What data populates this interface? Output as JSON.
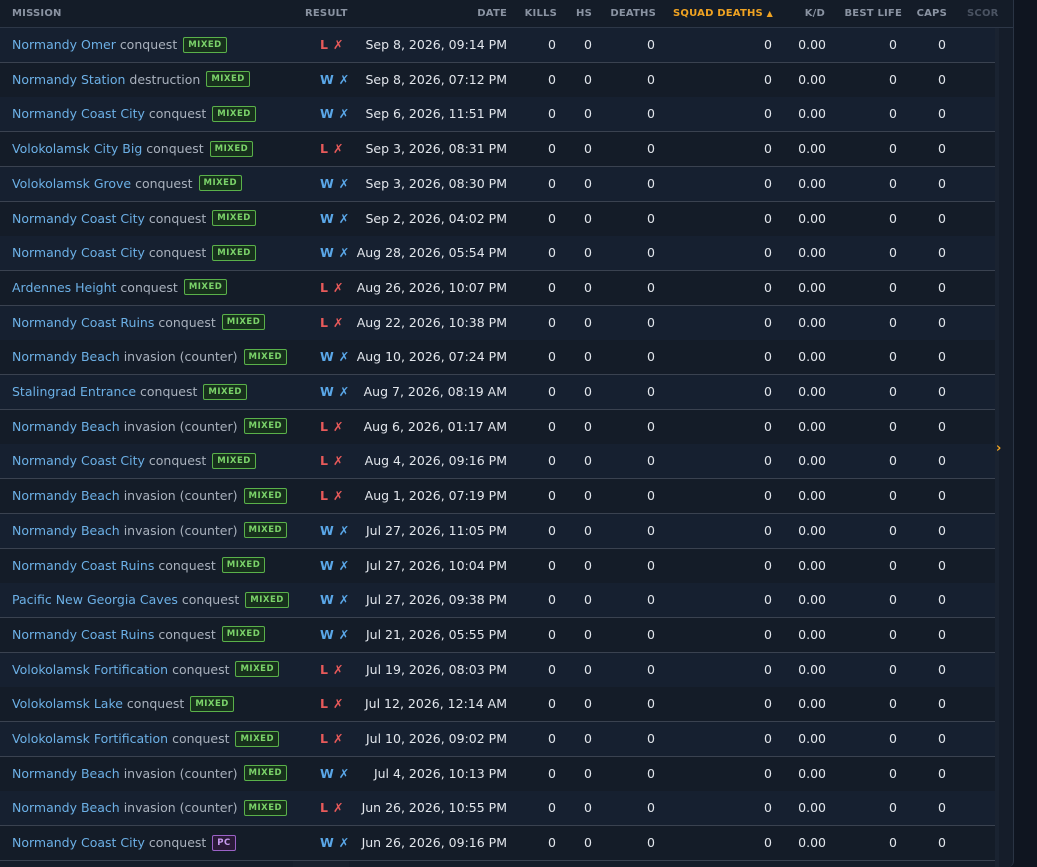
{
  "columns": {
    "mission": "MISSION",
    "result": "RESULT",
    "date": "DATE",
    "kills": "KILLS",
    "hs": "HS",
    "deaths": "DEATHS",
    "squad_deaths": "SQUAD DEATHS",
    "squad_deaths_sort": "▲",
    "kd": "K/D",
    "best_life": "BEST LIFE",
    "caps": "CAPS",
    "score": "SCOR"
  },
  "rows": [
    {
      "name": "Normandy Omer",
      "mode": "conquest",
      "badge": "MIXED",
      "result": "L",
      "date": "Sep 8, 2026, 09:14 PM",
      "kills": "0",
      "hs": "0",
      "deaths": "0",
      "squad_deaths": "0",
      "kd": "0.00",
      "best_life": "0",
      "caps": "0"
    },
    {
      "name": "Normandy Station",
      "mode": "destruction",
      "badge": "MIXED",
      "result": "W",
      "date": "Sep 8, 2026, 07:12 PM",
      "kills": "0",
      "hs": "0",
      "deaths": "0",
      "squad_deaths": "0",
      "kd": "0.00",
      "best_life": "0",
      "caps": "0"
    },
    {
      "name": "Normandy Coast City",
      "mode": "conquest",
      "badge": "MIXED",
      "result": "W",
      "date": "Sep 6, 2026, 11:51 PM",
      "kills": "0",
      "hs": "0",
      "deaths": "0",
      "squad_deaths": "0",
      "kd": "0.00",
      "best_life": "0",
      "caps": "0"
    },
    {
      "name": "Volokolamsk City Big",
      "mode": "conquest",
      "badge": "MIXED",
      "result": "L",
      "date": "Sep 3, 2026, 08:31 PM",
      "kills": "0",
      "hs": "0",
      "deaths": "0",
      "squad_deaths": "0",
      "kd": "0.00",
      "best_life": "0",
      "caps": "0"
    },
    {
      "name": "Volokolamsk Grove",
      "mode": "conquest",
      "badge": "MIXED",
      "result": "W",
      "date": "Sep 3, 2026, 08:30 PM",
      "kills": "0",
      "hs": "0",
      "deaths": "0",
      "squad_deaths": "0",
      "kd": "0.00",
      "best_life": "0",
      "caps": "0"
    },
    {
      "name": "Normandy Coast City",
      "mode": "conquest",
      "badge": "MIXED",
      "result": "W",
      "date": "Sep 2, 2026, 04:02 PM",
      "kills": "0",
      "hs": "0",
      "deaths": "0",
      "squad_deaths": "0",
      "kd": "0.00",
      "best_life": "0",
      "caps": "0"
    },
    {
      "name": "Normandy Coast City",
      "mode": "conquest",
      "badge": "MIXED",
      "result": "W",
      "date": "Aug 28, 2026, 05:54 PM",
      "kills": "0",
      "hs": "0",
      "deaths": "0",
      "squad_deaths": "0",
      "kd": "0.00",
      "best_life": "0",
      "caps": "0"
    },
    {
      "name": "Ardennes Height",
      "mode": "conquest",
      "badge": "MIXED",
      "result": "L",
      "date": "Aug 26, 2026, 10:07 PM",
      "kills": "0",
      "hs": "0",
      "deaths": "0",
      "squad_deaths": "0",
      "kd": "0.00",
      "best_life": "0",
      "caps": "0"
    },
    {
      "name": "Normandy Coast Ruins",
      "mode": "conquest",
      "badge": "MIXED",
      "result": "L",
      "date": "Aug 22, 2026, 10:38 PM",
      "kills": "0",
      "hs": "0",
      "deaths": "0",
      "squad_deaths": "0",
      "kd": "0.00",
      "best_life": "0",
      "caps": "0"
    },
    {
      "name": "Normandy Beach",
      "mode": "invasion (counter)",
      "badge": "MIXED",
      "result": "W",
      "date": "Aug 10, 2026, 07:24 PM",
      "kills": "0",
      "hs": "0",
      "deaths": "0",
      "squad_deaths": "0",
      "kd": "0.00",
      "best_life": "0",
      "caps": "0"
    },
    {
      "name": "Stalingrad Entrance",
      "mode": "conquest",
      "badge": "MIXED",
      "result": "W",
      "date": "Aug 7, 2026, 08:19 AM",
      "kills": "0",
      "hs": "0",
      "deaths": "0",
      "squad_deaths": "0",
      "kd": "0.00",
      "best_life": "0",
      "caps": "0"
    },
    {
      "name": "Normandy Beach",
      "mode": "invasion (counter)",
      "badge": "MIXED",
      "result": "L",
      "date": "Aug 6, 2026, 01:17 AM",
      "kills": "0",
      "hs": "0",
      "deaths": "0",
      "squad_deaths": "0",
      "kd": "0.00",
      "best_life": "0",
      "caps": "0"
    },
    {
      "name": "Normandy Coast City",
      "mode": "conquest",
      "badge": "MIXED",
      "result": "L",
      "date": "Aug 4, 2026, 09:16 PM",
      "kills": "0",
      "hs": "0",
      "deaths": "0",
      "squad_deaths": "0",
      "kd": "0.00",
      "best_life": "0",
      "caps": "0"
    },
    {
      "name": "Normandy Beach",
      "mode": "invasion (counter)",
      "badge": "MIXED",
      "result": "L",
      "date": "Aug 1, 2026, 07:19 PM",
      "kills": "0",
      "hs": "0",
      "deaths": "0",
      "squad_deaths": "0",
      "kd": "0.00",
      "best_life": "0",
      "caps": "0"
    },
    {
      "name": "Normandy Beach",
      "mode": "invasion (counter)",
      "badge": "MIXED",
      "result": "W",
      "date": "Jul 27, 2026, 11:05 PM",
      "kills": "0",
      "hs": "0",
      "deaths": "0",
      "squad_deaths": "0",
      "kd": "0.00",
      "best_life": "0",
      "caps": "0"
    },
    {
      "name": "Normandy Coast Ruins",
      "mode": "conquest",
      "badge": "MIXED",
      "result": "W",
      "date": "Jul 27, 2026, 10:04 PM",
      "kills": "0",
      "hs": "0",
      "deaths": "0",
      "squad_deaths": "0",
      "kd": "0.00",
      "best_life": "0",
      "caps": "0"
    },
    {
      "name": "Pacific New Georgia Caves",
      "mode": "conquest",
      "badge": "MIXED",
      "result": "W",
      "date": "Jul 27, 2026, 09:38 PM",
      "kills": "0",
      "hs": "0",
      "deaths": "0",
      "squad_deaths": "0",
      "kd": "0.00",
      "best_life": "0",
      "caps": "0"
    },
    {
      "name": "Normandy Coast Ruins",
      "mode": "conquest",
      "badge": "MIXED",
      "result": "W",
      "date": "Jul 21, 2026, 05:55 PM",
      "kills": "0",
      "hs": "0",
      "deaths": "0",
      "squad_deaths": "0",
      "kd": "0.00",
      "best_life": "0",
      "caps": "0"
    },
    {
      "name": "Volokolamsk Fortification",
      "mode": "conquest",
      "badge": "MIXED",
      "result": "L",
      "date": "Jul 19, 2026, 08:03 PM",
      "kills": "0",
      "hs": "0",
      "deaths": "0",
      "squad_deaths": "0",
      "kd": "0.00",
      "best_life": "0",
      "caps": "0"
    },
    {
      "name": "Volokolamsk Lake",
      "mode": "conquest",
      "badge": "MIXED",
      "result": "L",
      "date": "Jul 12, 2026, 12:14 AM",
      "kills": "0",
      "hs": "0",
      "deaths": "0",
      "squad_deaths": "0",
      "kd": "0.00",
      "best_life": "0",
      "caps": "0"
    },
    {
      "name": "Volokolamsk Fortification",
      "mode": "conquest",
      "badge": "MIXED",
      "result": "L",
      "date": "Jul 10, 2026, 09:02 PM",
      "kills": "0",
      "hs": "0",
      "deaths": "0",
      "squad_deaths": "0",
      "kd": "0.00",
      "best_life": "0",
      "caps": "0"
    },
    {
      "name": "Normandy Beach",
      "mode": "invasion (counter)",
      "badge": "MIXED",
      "result": "W",
      "date": "Jul 4, 2026, 10:13 PM",
      "kills": "0",
      "hs": "0",
      "deaths": "0",
      "squad_deaths": "0",
      "kd": "0.00",
      "best_life": "0",
      "caps": "0"
    },
    {
      "name": "Normandy Beach",
      "mode": "invasion (counter)",
      "badge": "MIXED",
      "result": "L",
      "date": "Jun 26, 2026, 10:55 PM",
      "kills": "0",
      "hs": "0",
      "deaths": "0",
      "squad_deaths": "0",
      "kd": "0.00",
      "best_life": "0",
      "caps": "0"
    },
    {
      "name": "Normandy Coast City",
      "mode": "conquest",
      "badge": "PC",
      "result": "W",
      "date": "Jun 26, 2026, 09:16 PM",
      "kills": "0",
      "hs": "0",
      "deaths": "0",
      "squad_deaths": "0",
      "kd": "0.00",
      "best_life": "0",
      "caps": "0"
    }
  ],
  "result_x_glyph": "✗",
  "scroll_right_glyph": "›",
  "colors": {
    "accent": "#f0a322",
    "win": "#5aa7e8",
    "loss": "#e85a5a",
    "mission_link": "#6cb0e6",
    "badge_mixed": "#7bd36a",
    "badge_pc": "#c89bf0"
  }
}
